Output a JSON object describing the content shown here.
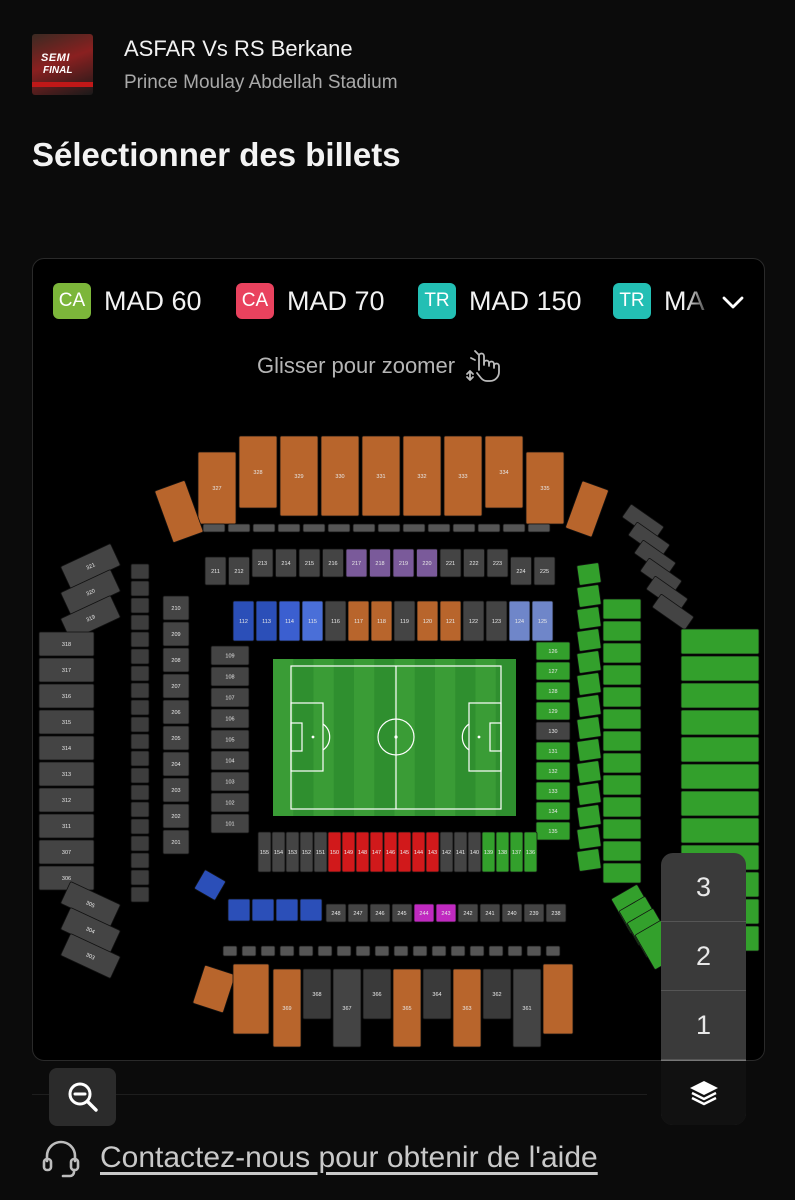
{
  "event": {
    "thumbnail_text_1": "SEMI",
    "thumbnail_text_2": "FINAL",
    "title": "ASFAR Vs RS Berkane",
    "venue": "Prince Moulay Abdellah Stadium"
  },
  "page_title": "Sélectionner des billets",
  "legend": {
    "items": [
      {
        "badge": "CA",
        "badge_color": "#7cb63a",
        "price": "MAD 60"
      },
      {
        "badge": "CA",
        "badge_color": "#e9425e",
        "price": "MAD 70"
      },
      {
        "badge": "TR",
        "badge_color": "#23bfb4",
        "price": "MAD 150"
      },
      {
        "badge": "TR",
        "badge_color": "#23bfb4",
        "price": "MA"
      }
    ],
    "expand_icon": "chevron-down-icon"
  },
  "hint": {
    "text": "Glisser pour zoomer",
    "icon": "pinch-zoom-icon"
  },
  "stadium_map": {
    "colors": {
      "orange": "#b8652c",
      "green": "#33a02c",
      "grey": "#444444",
      "blue_dark": "#2b4fb8",
      "blue_light": "#6f86c9",
      "red": "#d1191b",
      "purple": "#7a5a9a",
      "magenta": "#c02ac0",
      "pitch": "#2f8f2f"
    },
    "sections": {
      "top_upper": [
        "327",
        "328",
        "329",
        "330",
        "331",
        "332",
        "333",
        "334",
        "335"
      ],
      "top_middle": [
        "211",
        "212",
        "213",
        "214",
        "215",
        "216",
        "217",
        "218",
        "219",
        "220",
        "221",
        "222",
        "223",
        "224",
        "225"
      ],
      "top_lower": [
        "112",
        "113",
        "114",
        "115",
        "116",
        "117",
        "118",
        "119",
        "120",
        "121",
        "122",
        "123",
        "124",
        "125"
      ],
      "left_upper": [
        "321",
        "320",
        "319",
        "318",
        "317",
        "316",
        "315",
        "314",
        "313",
        "312",
        "311",
        "307",
        "306",
        "305",
        "304",
        "303"
      ],
      "left_middle": [
        "210",
        "209",
        "208",
        "207",
        "206",
        "205",
        "204",
        "203",
        "202",
        "201"
      ],
      "left_lower": [
        "109",
        "108",
        "107",
        "106",
        "105",
        "104",
        "103",
        "102",
        "101"
      ],
      "right_lower": [
        "126",
        "127",
        "128",
        "129",
        "130",
        "131",
        "132",
        "133",
        "134",
        "135"
      ],
      "bottom_lower": [
        "155",
        "154",
        "153",
        "152",
        "151",
        "150",
        "149",
        "148",
        "147",
        "146",
        "145",
        "144",
        "143",
        "142",
        "141",
        "140",
        "139",
        "138",
        "137",
        "136"
      ],
      "bottom_middle": [
        "248",
        "247",
        "246",
        "245",
        "244",
        "243",
        "242",
        "241",
        "240",
        "239",
        "238"
      ],
      "bottom_upper": [
        "369",
        "368",
        "367",
        "366",
        "365",
        "364",
        "363",
        "362",
        "361"
      ]
    }
  },
  "levels": [
    "3",
    "2",
    "1"
  ],
  "layers_icon": "layers-icon",
  "zoom_icon": "zoom-out-icon",
  "help": {
    "text": "Contactez-nous pour obtenir de l'aide",
    "icon": "headset-icon"
  }
}
